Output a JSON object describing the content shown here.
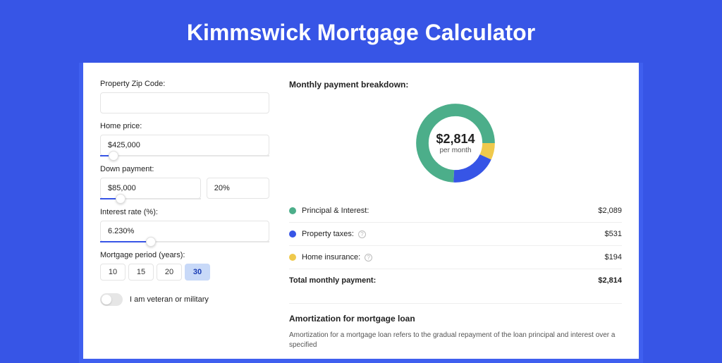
{
  "page": {
    "title": "Kimmswick Mortgage Calculator"
  },
  "form": {
    "zip": {
      "label": "Property Zip Code:",
      "value": ""
    },
    "home_price": {
      "label": "Home price:",
      "value": "$425,000",
      "slider_pct": 8
    },
    "down_payment": {
      "label": "Down payment:",
      "value": "$85,000",
      "percent": "20%",
      "slider_pct": 20
    },
    "interest": {
      "label": "Interest rate (%):",
      "value": "6.230%",
      "slider_pct": 30
    },
    "period_label": "Mortgage period (years):",
    "periods": [
      "10",
      "15",
      "20",
      "30"
    ],
    "period_selected": "30",
    "veteran_label": "I am veteran or military"
  },
  "breakdown": {
    "title": "Monthly payment breakdown:",
    "center_amount": "$2,814",
    "center_sub": "per month",
    "items": [
      {
        "label": "Principal & Interest:",
        "value": "$2,089",
        "color": "#4cae8a",
        "info": false
      },
      {
        "label": "Property taxes:",
        "value": "$531",
        "color": "#3755e6",
        "info": true
      },
      {
        "label": "Home insurance:",
        "value": "$194",
        "color": "#efc94c",
        "info": true
      }
    ],
    "total": {
      "label": "Total monthly payment:",
      "value": "$2,814"
    }
  },
  "amort": {
    "title": "Amortization for mortgage loan",
    "text": "Amortization for a mortgage loan refers to the gradual repayment of the loan principal and interest over a specified"
  },
  "chart_data": {
    "type": "pie",
    "title": "Monthly payment breakdown",
    "series": [
      {
        "name": "Principal & Interest",
        "value": 2089,
        "color": "#4cae8a"
      },
      {
        "name": "Property taxes",
        "value": 531,
        "color": "#3755e6"
      },
      {
        "name": "Home insurance",
        "value": 194,
        "color": "#efc94c"
      }
    ],
    "total": 2814,
    "angles_deg": {
      "home_insurance": [
        0,
        25
      ],
      "property_taxes": [
        25,
        93
      ],
      "principal_interest": [
        93,
        360
      ]
    }
  }
}
